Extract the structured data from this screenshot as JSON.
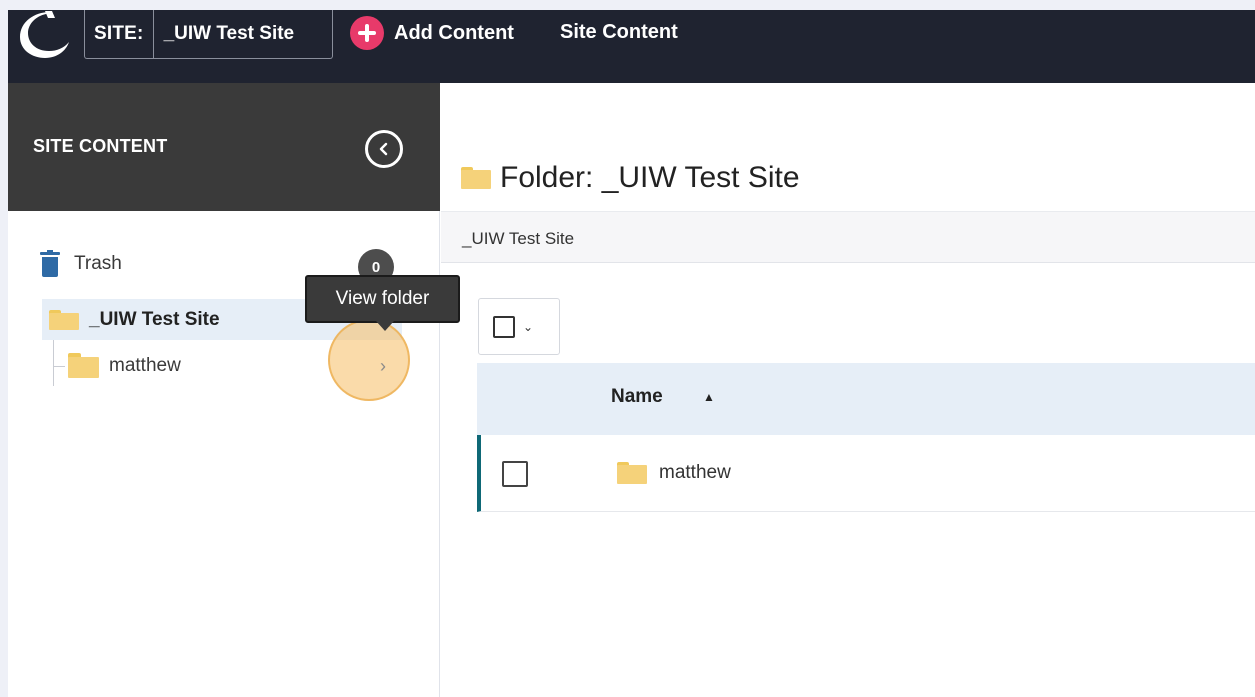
{
  "header": {
    "site_label": "SITE:",
    "site_name": "_UIW Test Site",
    "add_content_label": "Add Content",
    "site_content_label": "Site Content"
  },
  "sidebar": {
    "title": "SITE CONTENT",
    "trash_label": "Trash",
    "trash_count": "0",
    "tree": {
      "root_label": "_UIW Test Site",
      "child_label": "matthew"
    },
    "tooltip": "View folder"
  },
  "main": {
    "folder_title": "Folder: _UIW Test Site",
    "breadcrumb": "_UIW Test Site",
    "table": {
      "column_name": "Name",
      "rows": [
        {
          "name": "matthew"
        }
      ]
    }
  },
  "colors": {
    "topbar_bg": "#1f2330",
    "accent_pink": "#e83a6a",
    "sidebar_header_bg": "#3a3a3a",
    "selected_row_bg": "#e6eef7",
    "row_accent": "#0e6876",
    "folder_yellow": "#f5d27a",
    "trash_blue": "#2e6aa5"
  }
}
